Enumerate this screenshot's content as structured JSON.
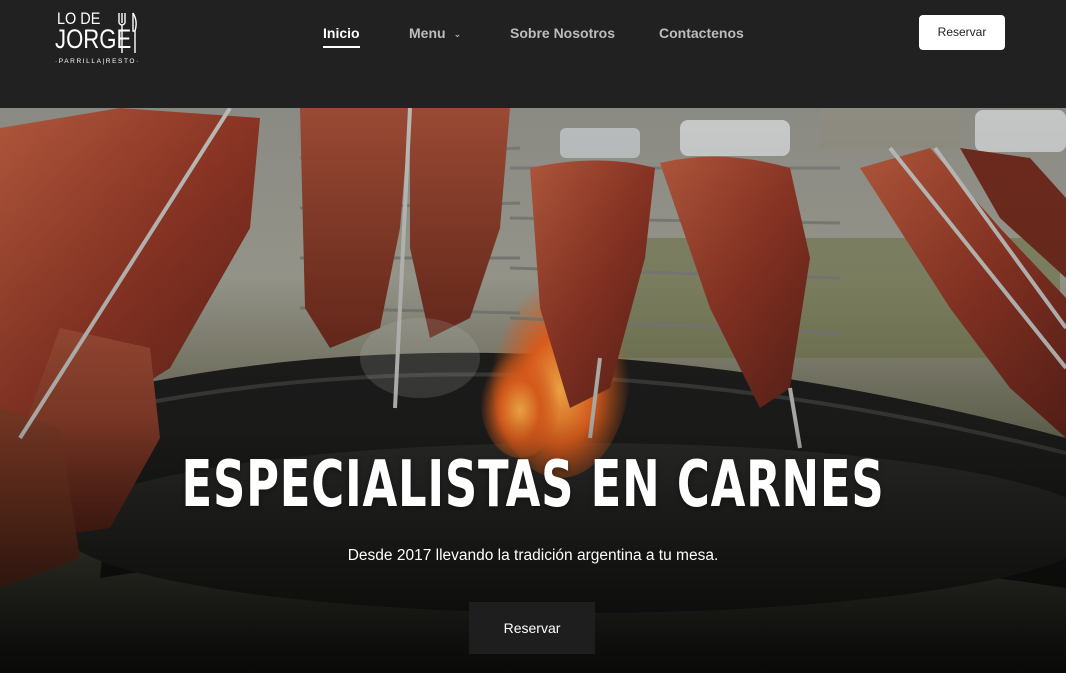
{
  "logo": {
    "line1": "LO DE",
    "line2": "JORGE",
    "tagline": "·PARRILLA|RESTO·"
  },
  "nav": {
    "items": [
      {
        "label": "Inicio",
        "active": true
      },
      {
        "label": "Menu",
        "has_dropdown": true
      },
      {
        "label": "Sobre Nosotros"
      },
      {
        "label": "Contactenos"
      }
    ],
    "dropdown_icon": "⌃"
  },
  "header_button": "Reservar",
  "hero": {
    "title": "ESPECIALISTAS EN CARNES",
    "subtitle": "Desde 2017 llevando la tradición argentina a tu mesa.",
    "button": "Reservar"
  },
  "colors": {
    "header_bg": "#202120",
    "nav_active": "#ffffff",
    "nav_inactive": "#bdbdbd",
    "hero_button_bg": "#1e1e1e"
  }
}
